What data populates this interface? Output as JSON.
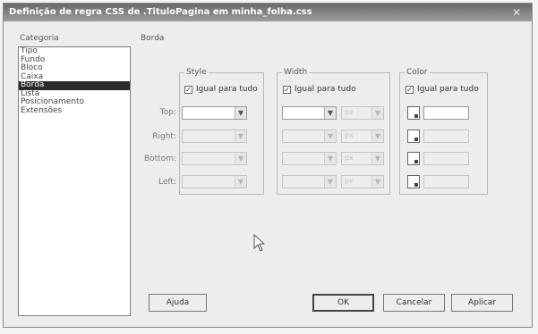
{
  "window": {
    "title": "Definição de regra CSS de .TituloPagina em minha_folha.css",
    "close_glyph": "✕"
  },
  "category": {
    "label": "Categoria",
    "items": [
      "Tipo",
      "Fundo",
      "Bloco",
      "Caixa",
      "Borda",
      "Lista",
      "Posicionamento",
      "Extensões"
    ],
    "selected": "Borda"
  },
  "section": {
    "label": "Borda"
  },
  "groups": {
    "style": {
      "title": "Style",
      "same_for_all": "Igual para tudo",
      "checked": true
    },
    "width": {
      "title": "Width",
      "same_for_all": "Igual para tudo",
      "checked": true,
      "unit": "px"
    },
    "color": {
      "title": "Color",
      "same_for_all": "Igual para tudo",
      "checked": true
    }
  },
  "rows": {
    "top": "Top:",
    "right": "Right:",
    "bottom": "Bottom:",
    "left": "Left:"
  },
  "buttons": {
    "help": "Ajuda",
    "ok": "OK",
    "cancel": "Cancelar",
    "apply": "Aplicar"
  },
  "icons": {
    "dropdown": "▼",
    "check": "✓"
  }
}
